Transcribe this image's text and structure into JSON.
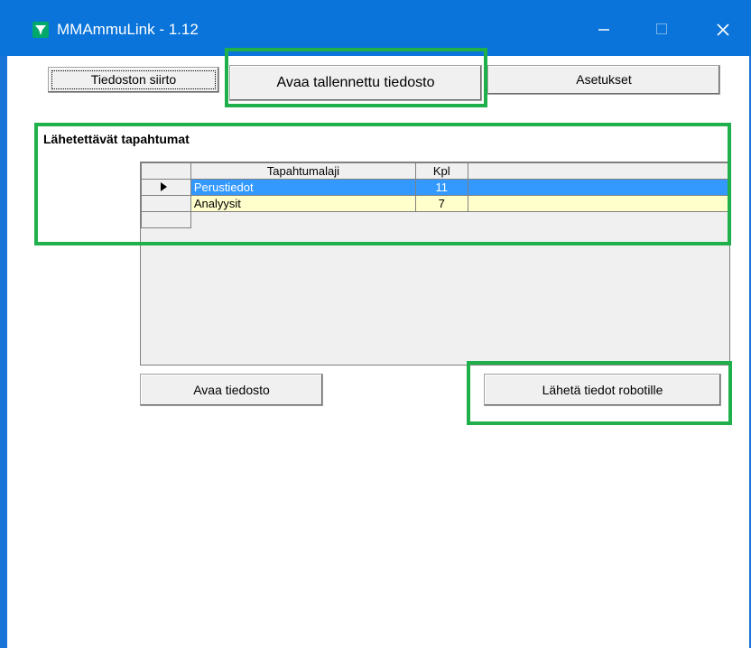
{
  "window": {
    "title": "MMAmmuLink - 1.12",
    "accent_color": "#0a74da",
    "highlight_color": "#20b04b"
  },
  "toolbar": {
    "tabs": [
      {
        "label": "Tiedoston siirto"
      },
      {
        "label": "Avaa tallennettu tiedosto"
      },
      {
        "label": "Asetukset"
      }
    ]
  },
  "section": {
    "title": "Lähetettävät tapahtumat"
  },
  "grid": {
    "columns": [
      "Tapahtumalaji",
      "Kpl"
    ],
    "rows": [
      {
        "type": "Perustiedot",
        "count": "11",
        "selected": true
      },
      {
        "type": "Analyysit",
        "count": "7",
        "selected": false
      }
    ]
  },
  "buttons": {
    "open_file": "Avaa tiedosto",
    "send_to_robot": "Lähetä tiedot robotille"
  }
}
